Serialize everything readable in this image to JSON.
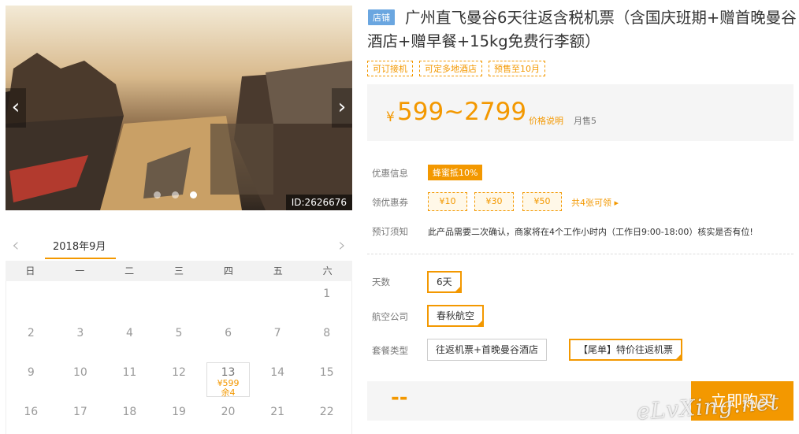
{
  "gallery": {
    "prev_arrow": "‹",
    "next_arrow": "›",
    "photo_id": "ID:2626676",
    "slide_count": 3,
    "active_slide": 2
  },
  "calendar": {
    "prev": "‹",
    "next": "›",
    "month": "2018年9月",
    "weekdays": [
      "日",
      "一",
      "二",
      "三",
      "四",
      "五",
      "六"
    ],
    "rows": [
      [
        "",
        "",
        "",
        "",
        "",
        "",
        "1"
      ],
      [
        "2",
        "3",
        "4",
        "5",
        "6",
        "7",
        "8"
      ],
      [
        "9",
        "10",
        "11",
        "12",
        "13",
        "14",
        "15"
      ],
      [
        "16",
        "17",
        "18",
        "19",
        "20",
        "21",
        "22"
      ]
    ],
    "available": {
      "day": "13",
      "price": "¥599",
      "stock": "余4"
    }
  },
  "product": {
    "store_badge": "店铺",
    "title": "广州直飞曼谷6天往返含税机票（含国庆班期+赠首晚曼谷酒店+赠早餐+15kg免费行李额）",
    "tags": [
      "可订接机",
      "可定多地酒店",
      "预售至10月"
    ]
  },
  "price": {
    "yen": "¥",
    "range": "599~2799",
    "explain": "价格说明",
    "monthly_sales": "月售5"
  },
  "info": {
    "promo_label": "优惠信息",
    "promo_badge": "蜂蜜抵10%",
    "coupon_label": "领优惠券",
    "coupons": [
      "¥10",
      "¥30",
      "¥50"
    ],
    "coupon_more": "共4张可领 ▸",
    "notice_label": "预订须知",
    "notice_text": "此产品需要二次确认，商家将在4个工作小时内（工作日9:00-18:00）核实是否有位!"
  },
  "options": {
    "days_label": "天数",
    "days_value": "6天",
    "airline_label": "航空公司",
    "airline_value": "春秋航空",
    "package_label": "套餐类型",
    "package_a": "往返机票+首晚曼谷酒店",
    "package_b": "【尾单】特价往返机票"
  },
  "buy": {
    "dash": "--",
    "button": "立即购买"
  },
  "watermark": "eLvXing.net",
  "colors": {
    "accent": "#f39800",
    "store_badge": "#6aa6e0"
  }
}
